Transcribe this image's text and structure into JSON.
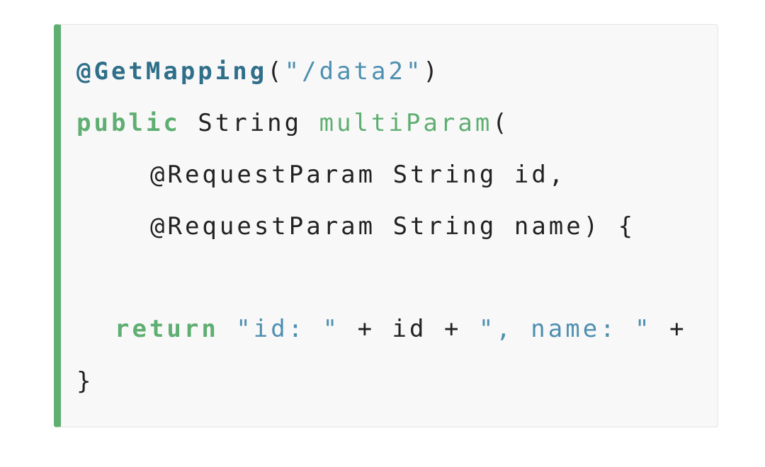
{
  "colors": {
    "accent_bar": "#5fae72",
    "annotation": "#2f6f8a",
    "keyword": "#5fae72",
    "string": "#4e8fb0",
    "text": "#222222",
    "background": "#f8f8f8"
  },
  "code": {
    "line1": {
      "annotation": "@GetMapping",
      "paren_open": "(",
      "path": "\"/data2\"",
      "paren_close": ")"
    },
    "line2": {
      "keyword": "public",
      "type": " String ",
      "method": "multiParam",
      "paren_open": "("
    },
    "line3": {
      "text": "@RequestParam String id,"
    },
    "line4": {
      "text": "@RequestParam String name) {"
    },
    "line6": {
      "keyword": "return",
      "str1": " \"id: \"",
      "op1": " + id + ",
      "str2": "\", name: \"",
      "op2": " +"
    },
    "line7": {
      "text": "}"
    }
  }
}
